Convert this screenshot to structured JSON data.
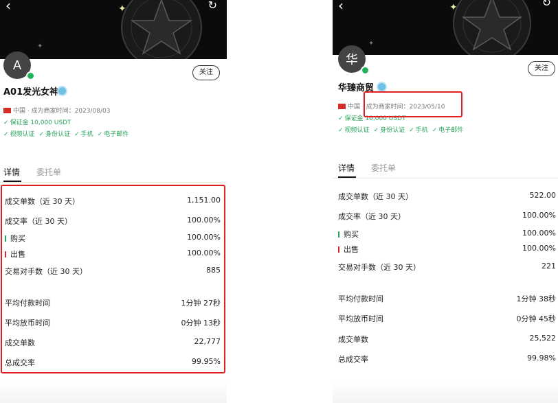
{
  "left": {
    "avatar_letter": "A",
    "follow_label": "关注",
    "merchant_name": "A01发光女神",
    "region": "中国",
    "merchant_since_label": "成为商家时间：",
    "merchant_since_date": "2023/08/03",
    "deposit": "保证金 10,000 USDT",
    "verifications": [
      "视频认证",
      "身份认证",
      "手机",
      "电子邮件"
    ],
    "tabs": [
      "详情",
      "委托单"
    ],
    "stats": {
      "orders_30d_label": "成交单数（近 30 天）",
      "orders_30d_value": "1,151.00",
      "rate_30d_label": "成交率（近 30 天）",
      "rate_30d_value": "100.00%",
      "buy_label": "购买",
      "buy_value": "100.00%",
      "sell_label": "出售",
      "sell_value": "100.00%",
      "counterparties_label": "交易对手数（近 30 天）",
      "counterparties_value": "885",
      "avg_pay_label": "平均付款时间",
      "avg_pay_value": "1分钟 27秒",
      "avg_release_label": "平均放币时间",
      "avg_release_value": "0分钟 13秒",
      "total_orders_label": "成交单数",
      "total_orders_value": "22,777",
      "total_rate_label": "总成交率",
      "total_rate_value": "99.95%"
    }
  },
  "right": {
    "avatar_letter": "华",
    "follow_label": "关注",
    "merchant_name": "华臻商贸",
    "region": "中国",
    "merchant_since_label": "成为商家时间：",
    "merchant_since_date": "2023/05/10",
    "deposit": "保证金 10,000 USDT",
    "verifications": [
      "视频认证",
      "身份认证",
      "手机",
      "电子邮件"
    ],
    "tabs": [
      "详情",
      "委托单"
    ],
    "stats": {
      "orders_30d_label": "成交单数（近 30 天）",
      "orders_30d_value": "522.00",
      "rate_30d_label": "成交率（近 30 天）",
      "rate_30d_value": "100.00%",
      "buy_label": "购买",
      "buy_value": "100.00%",
      "sell_label": "出售",
      "sell_value": "100.00%",
      "counterparties_label": "交易对手数（近 30 天）",
      "counterparties_value": "221",
      "avg_pay_label": "平均付款时间",
      "avg_pay_value": "1分钟 38秒",
      "avg_release_label": "平均放币时间",
      "avg_release_value": "0分钟 45秒",
      "total_orders_label": "成交单数",
      "total_orders_value": "25,522",
      "total_rate_label": "总成交率",
      "total_rate_value": "99.98%"
    }
  },
  "colors": {
    "highlight": "#e02020",
    "verified_green": "#27a35a",
    "hero_bg": "#0b0b0b"
  }
}
